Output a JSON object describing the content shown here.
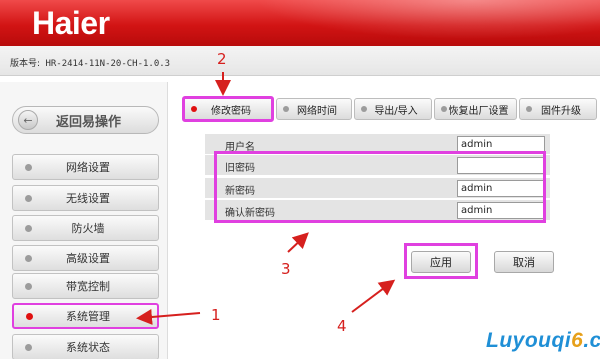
{
  "header": {
    "logo": "Haier"
  },
  "version": {
    "label": "版本号:",
    "value": "HR-2414-11N-20-CH-1.0.3"
  },
  "sidebar": {
    "back_label": "返回易操作",
    "items": [
      {
        "label": "网络设置"
      },
      {
        "label": "无线设置"
      },
      {
        "label": "防火墙"
      },
      {
        "label": "高级设置"
      },
      {
        "label": "带宽控制"
      },
      {
        "label": "系统管理"
      },
      {
        "label": "系统状态"
      }
    ]
  },
  "tabs": [
    {
      "label": "修改密码"
    },
    {
      "label": "网络时间"
    },
    {
      "label": "导出/导入"
    },
    {
      "label": "恢复出厂设置"
    },
    {
      "label": "固件升级"
    }
  ],
  "form": {
    "username": {
      "label": "用户名",
      "value": "admin"
    },
    "old_password": {
      "label": "旧密码",
      "value": ""
    },
    "new_password": {
      "label": "新密码",
      "value": "admin"
    },
    "confirm_password": {
      "label": "确认新密码",
      "value": "admin"
    }
  },
  "actions": {
    "apply": "应用",
    "cancel": "取消"
  },
  "annotations": {
    "n1": "1",
    "n2": "2",
    "n3": "3",
    "n4": "4",
    "arrow_color": "#d6201e",
    "highlight_color": "#e040e0"
  },
  "watermark": {
    "part1": "Luyouqi",
    "part2": "6",
    "part3": ".cn"
  }
}
